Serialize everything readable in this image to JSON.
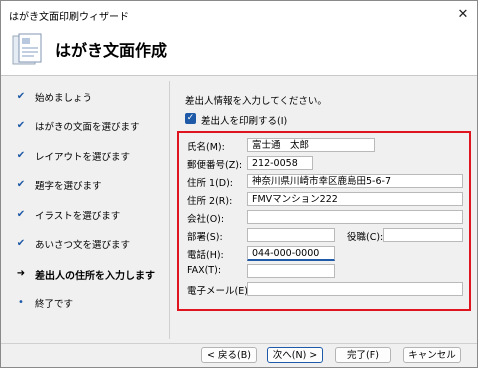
{
  "window": {
    "title": "はがき文面印刷ウィザード",
    "close_glyph": "✕"
  },
  "header": {
    "title": "はがき文面作成"
  },
  "sidebar": {
    "items": [
      {
        "label": "始めましょう",
        "mark": "✔"
      },
      {
        "label": "はがきの文面を選びます",
        "mark": "✔"
      },
      {
        "label": "レイアウトを選びます",
        "mark": "✔"
      },
      {
        "label": "題字を選びます",
        "mark": "✔"
      },
      {
        "label": "イラストを選びます",
        "mark": "✔"
      },
      {
        "label": "あいさつ文を選びます",
        "mark": "✔"
      },
      {
        "label": "差出人の住所を入力します",
        "mark": "➜"
      },
      {
        "label": "終了です",
        "mark": "•"
      }
    ]
  },
  "main": {
    "intro": "差出人情報を入力してください。",
    "print_sender": {
      "label": "差出人を印刷する(I)",
      "checked": true
    },
    "fields": {
      "name": {
        "label": "氏名(M):",
        "value": "富士通　太郎"
      },
      "postal": {
        "label": "郵便番号(Z):",
        "value": "212-0058"
      },
      "address1": {
        "label": "住所 1(D):",
        "value": "神奈川県川崎市幸区鹿島田5-6-7"
      },
      "address2": {
        "label": "住所 2(R):",
        "value": "FMVマンション222"
      },
      "company": {
        "label": "会社(O):",
        "value": ""
      },
      "department": {
        "label": "部署(S):",
        "value": ""
      },
      "title": {
        "label": "役職(C):",
        "value": ""
      },
      "phone": {
        "label": "電話(H):",
        "value": "044-000-0000"
      },
      "fax": {
        "label": "FAX(T):",
        "value": ""
      },
      "email": {
        "label": "電子メール(E):",
        "value": ""
      }
    }
  },
  "buttons": {
    "back": "< 戻る(B)",
    "next": "次へ(N) >",
    "finish": "完了(F)",
    "cancel": "キャンセル"
  },
  "colors": {
    "accent": "#1e5aa8",
    "highlight_border": "#e0141e"
  }
}
